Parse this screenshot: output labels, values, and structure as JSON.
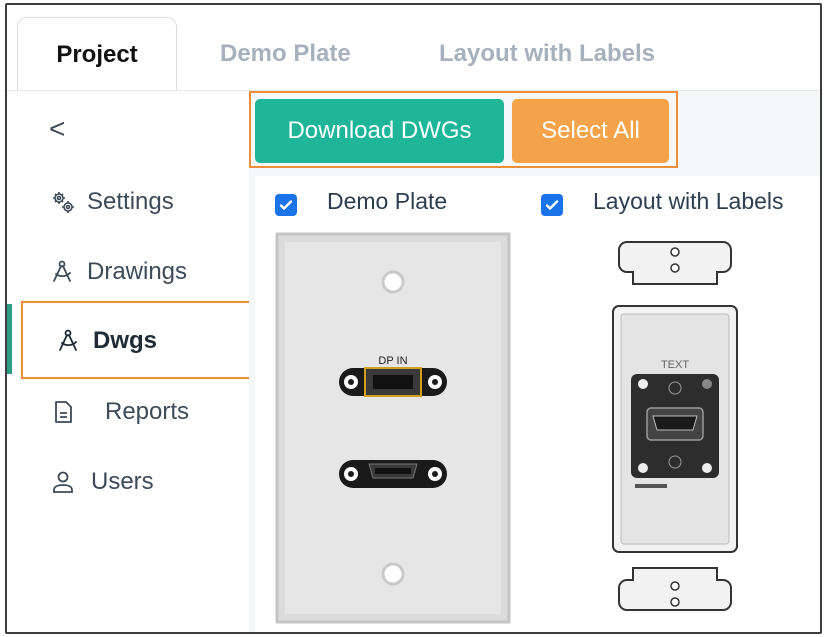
{
  "tabs": [
    {
      "label": "Project"
    },
    {
      "label": "Demo Plate"
    },
    {
      "label": "Layout with Labels"
    }
  ],
  "sidebar": {
    "collapse_glyph": "<",
    "items": [
      {
        "label": "Settings",
        "icon": "gears-icon"
      },
      {
        "label": "Drawings",
        "icon": "compass-icon"
      },
      {
        "label": "Dwgs",
        "icon": "compass-icon"
      },
      {
        "label": "Reports",
        "icon": "document-icon"
      },
      {
        "label": "Users",
        "icon": "user-icon"
      }
    ]
  },
  "toolbar": {
    "download_label": "Download DWGs",
    "select_all_label": "Select All"
  },
  "cards": [
    {
      "label": "Demo Plate",
      "checked": true,
      "connector_label": "DP IN"
    },
    {
      "label": "Layout with Labels",
      "checked": true,
      "text_label": "TEXT"
    }
  ],
  "colors": {
    "accent_green": "#1fb598",
    "accent_orange": "#f4a34a",
    "highlight_outline": "#ee8e3b",
    "checkbox_blue": "#1a73e8"
  }
}
